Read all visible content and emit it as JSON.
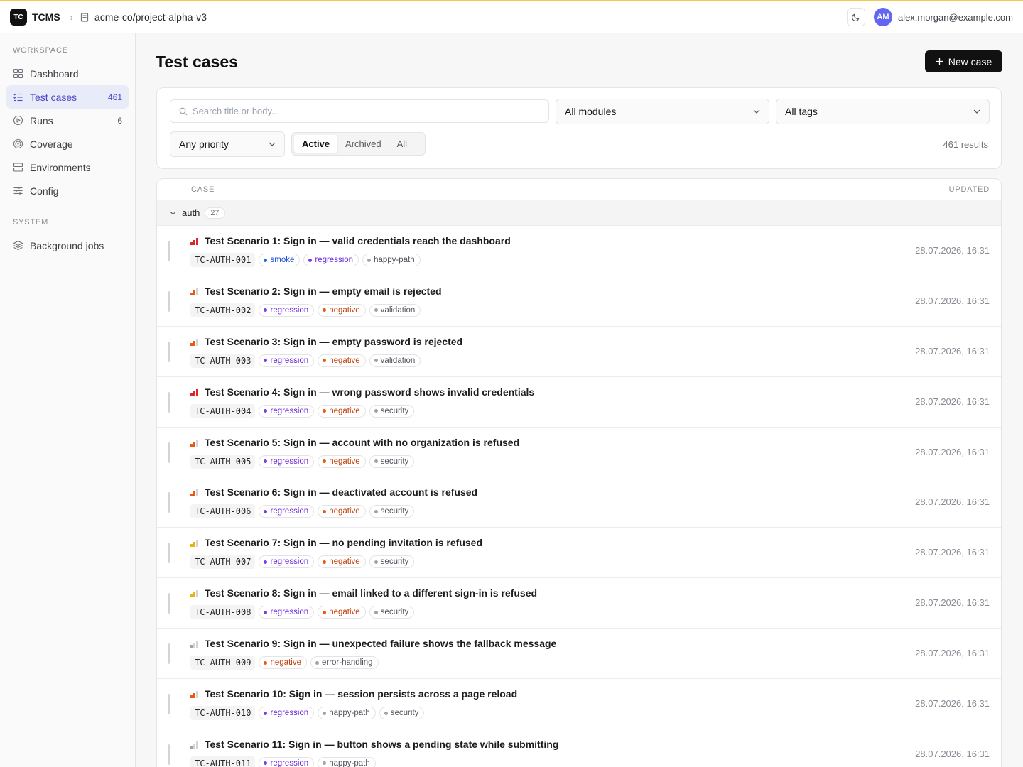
{
  "topbar": {
    "logo": "TC",
    "brand": "TCMS",
    "repo": "acme-co/project-alpha-v3",
    "avatar_initials": "AM",
    "email": "alex.morgan@example.com"
  },
  "sidebar": {
    "workspace_label": "WORKSPACE",
    "system_label": "SYSTEM",
    "items": [
      {
        "label": "Dashboard",
        "count": "",
        "icon": "dashboard-icon"
      },
      {
        "label": "Test cases",
        "count": "461",
        "icon": "list-check-icon",
        "active": true
      },
      {
        "label": "Runs",
        "count": "6",
        "icon": "play-circle-icon"
      },
      {
        "label": "Coverage",
        "count": "",
        "icon": "target-icon"
      },
      {
        "label": "Environments",
        "count": "",
        "icon": "server-icon"
      },
      {
        "label": "Config",
        "count": "",
        "icon": "sliders-icon"
      }
    ],
    "system_items": [
      {
        "label": "Background jobs",
        "icon": "layers-icon"
      }
    ]
  },
  "main": {
    "title": "Test cases",
    "new_button": "New case",
    "search_placeholder": "Search title or body...",
    "modules_select": "All modules",
    "tags_select": "All tags",
    "priority_select": "Any priority",
    "status_tabs": [
      "Active",
      "Archived",
      "All"
    ],
    "results": "461 results",
    "col_case": "CASE",
    "col_updated": "UPDATED"
  },
  "group": {
    "name": "auth",
    "count": "27"
  },
  "colors": {
    "accent": "#4f46c9",
    "prio_critical": "#dc2626",
    "prio_high": "#ea580c",
    "prio_medium": "#eab308",
    "prio_low": "#a1a1aa",
    "tag_smoke": "#2563eb",
    "tag_regression": "#7c3aed",
    "tag_negative": "#ea580c",
    "tag_neutral": "#a1a1aa"
  },
  "rows": [
    {
      "title": "Test Scenario 1: Sign in — valid credentials reach the dashboard",
      "code": "TC-AUTH-001",
      "priority": 4,
      "date": "28.07.2026, 16:31",
      "tags": [
        "smoke",
        "regression",
        "happy-path"
      ]
    },
    {
      "title": "Test Scenario 2: Sign in — empty email is rejected",
      "code": "TC-AUTH-002",
      "priority": 3,
      "date": "28.07.2026, 16:31",
      "tags": [
        "regression",
        "negative",
        "validation"
      ]
    },
    {
      "title": "Test Scenario 3: Sign in — empty password is rejected",
      "code": "TC-AUTH-003",
      "priority": 3,
      "date": "28.07.2026, 16:31",
      "tags": [
        "regression",
        "negative",
        "validation"
      ]
    },
    {
      "title": "Test Scenario 4: Sign in — wrong password shows invalid credentials",
      "code": "TC-AUTH-004",
      "priority": 4,
      "date": "28.07.2026, 16:31",
      "tags": [
        "regression",
        "negative",
        "security"
      ]
    },
    {
      "title": "Test Scenario 5: Sign in — account with no organization is refused",
      "code": "TC-AUTH-005",
      "priority": 3,
      "date": "28.07.2026, 16:31",
      "tags": [
        "regression",
        "negative",
        "security"
      ]
    },
    {
      "title": "Test Scenario 6: Sign in — deactivated account is refused",
      "code": "TC-AUTH-006",
      "priority": 3,
      "date": "28.07.2026, 16:31",
      "tags": [
        "regression",
        "negative",
        "security"
      ]
    },
    {
      "title": "Test Scenario 7: Sign in — no pending invitation is refused",
      "code": "TC-AUTH-007",
      "priority": 2,
      "date": "28.07.2026, 16:31",
      "tags": [
        "regression",
        "negative",
        "security"
      ]
    },
    {
      "title": "Test Scenario 8: Sign in — email linked to a different sign-in is refused",
      "code": "TC-AUTH-008",
      "priority": 2,
      "date": "28.07.2026, 16:31",
      "tags": [
        "regression",
        "negative",
        "security"
      ]
    },
    {
      "title": "Test Scenario 9: Sign in — unexpected failure shows the fallback message",
      "code": "TC-AUTH-009",
      "priority": 1,
      "date": "28.07.2026, 16:31",
      "tags": [
        "negative",
        "error-handling"
      ]
    },
    {
      "title": "Test Scenario 10: Sign in — session persists across a page reload",
      "code": "TC-AUTH-010",
      "priority": 3,
      "date": "28.07.2026, 16:31",
      "tags": [
        "regression",
        "happy-path",
        "security"
      ]
    },
    {
      "title": "Test Scenario 11: Sign in — button shows a pending state while submitting",
      "code": "TC-AUTH-011",
      "priority": 1,
      "date": "28.07.2026, 16:31",
      "tags": [
        "regression",
        "happy-path"
      ]
    }
  ]
}
